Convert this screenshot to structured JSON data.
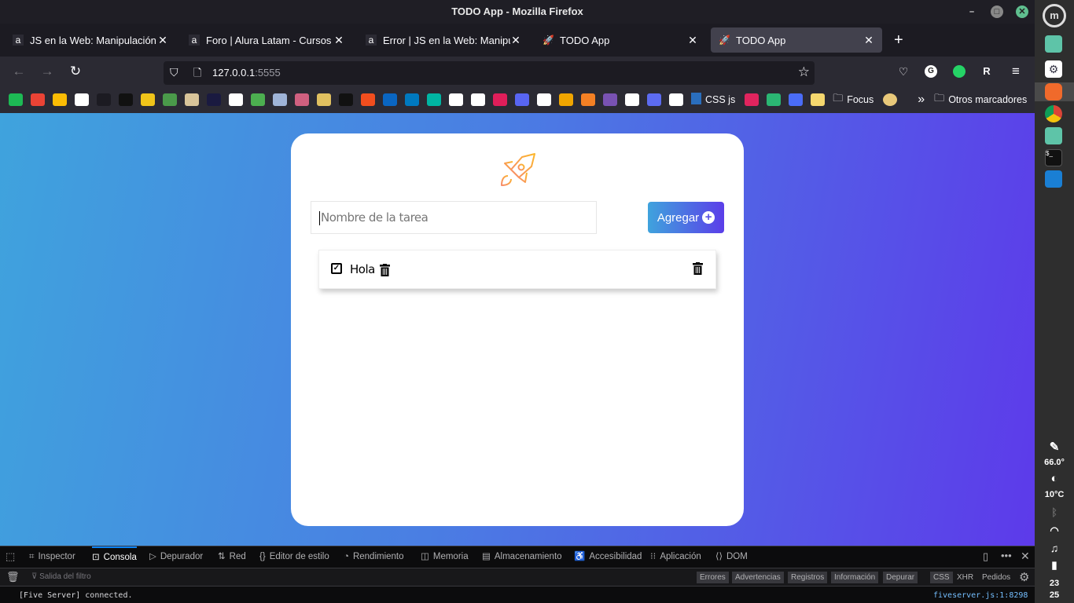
{
  "window": {
    "title": "TODO App - Mozilla Firefox"
  },
  "tabs": [
    {
      "title": "JS en la Web: Manipulación del",
      "icon": "alura-icon"
    },
    {
      "title": "Foro | Alura Latam - Cursos onli",
      "icon": "alura-icon"
    },
    {
      "title": "Error | JS en la Web: Manipulaci",
      "icon": "alura-icon"
    },
    {
      "title": "TODO App",
      "icon": "rocket-icon"
    },
    {
      "title": "TODO App",
      "icon": "rocket-icon",
      "active": true
    }
  ],
  "navbar": {
    "url_host": "127.0.0.1",
    "url_port": ":5555"
  },
  "bookmarks": {
    "icons": [
      {
        "name": "spotify",
        "color": "#1db954"
      },
      {
        "name": "gmail",
        "color": "#ea4335"
      },
      {
        "name": "google-drive",
        "color": "#fbbc04"
      },
      {
        "name": "notion",
        "color": "#ffffff"
      },
      {
        "name": "alura",
        "color": "#1c1b22"
      },
      {
        "name": "coder",
        "color": "#111111"
      },
      {
        "name": "js",
        "color": "#f0c419"
      },
      {
        "name": "w3",
        "color": "#4a9a4a"
      },
      {
        "name": "hero",
        "color": "#d8c49a"
      },
      {
        "name": "lambda",
        "color": "#1a1a40"
      },
      {
        "name": "slash",
        "color": "#ffffff"
      },
      {
        "name": "figure-green",
        "color": "#4caf50"
      },
      {
        "name": "picture-1",
        "color": "#9fb4d8"
      },
      {
        "name": "figure-pink",
        "color": "#d06080"
      },
      {
        "name": "picture-2",
        "color": "#e0c060"
      },
      {
        "name": "hackerrank",
        "color": "#111111"
      },
      {
        "name": "figma",
        "color": "#f24e1e"
      },
      {
        "name": "linkedin",
        "color": "#0a66c2"
      },
      {
        "name": "trello",
        "color": "#0079bf"
      },
      {
        "name": "diamond",
        "color": "#00b5a3"
      },
      {
        "name": "github",
        "color": "#ffffff"
      },
      {
        "name": "notion-2",
        "color": "#ffffff"
      },
      {
        "name": "slack",
        "color": "#e01e5a"
      },
      {
        "name": "discord",
        "color": "#5865f2"
      },
      {
        "name": "codepen",
        "color": "#ffffff"
      },
      {
        "name": "stackoverflow-1",
        "color": "#f0a500"
      },
      {
        "name": "stackoverflow-2",
        "color": "#f48024"
      },
      {
        "name": "bootstrap",
        "color": "#7952b3"
      },
      {
        "name": "google-dev",
        "color": "#ffffff"
      },
      {
        "name": "azure",
        "color": "#5c6bf0"
      },
      {
        "name": "w3-validator",
        "color": "#ffffff"
      }
    ],
    "css_js": "CSS js",
    "after_icons": [
      {
        "name": "id",
        "color": "#e0245e"
      },
      {
        "name": "m",
        "color": "#2bb673"
      },
      {
        "name": "bars",
        "color": "#4a6cf7"
      },
      {
        "name": "y-bookmark",
        "color": "#f5d76e"
      }
    ],
    "focus": "Focus",
    "others": "Otros marcadores"
  },
  "app": {
    "input_placeholder": "Nombre de la tarea",
    "add_button": "Agregar",
    "tasks": [
      {
        "title": "Hola",
        "checked": true
      }
    ]
  },
  "devtools": {
    "tabs": [
      "Inspector",
      "Consola",
      "Depurador",
      "Red",
      "Editor de estilo",
      "Rendimiento",
      "Memoria",
      "Almacenamiento",
      "Accesibilidad",
      "Aplicación",
      "DOM"
    ],
    "active_tab": "Consola",
    "filter_placeholder": "Salida del filtro",
    "levels": [
      "Errores",
      "Advertencias",
      "Registros",
      "Información",
      "Depurar"
    ],
    "types": [
      "CSS",
      "XHR",
      "Pedidos"
    ],
    "log": {
      "message": "[Five Server] connected.",
      "source": "fiveserver.js:1:8298"
    }
  },
  "panel": {
    "temp_cpu": "66.0°",
    "weather": "10°C",
    "clock_hour": "23",
    "clock_minute": "25"
  }
}
